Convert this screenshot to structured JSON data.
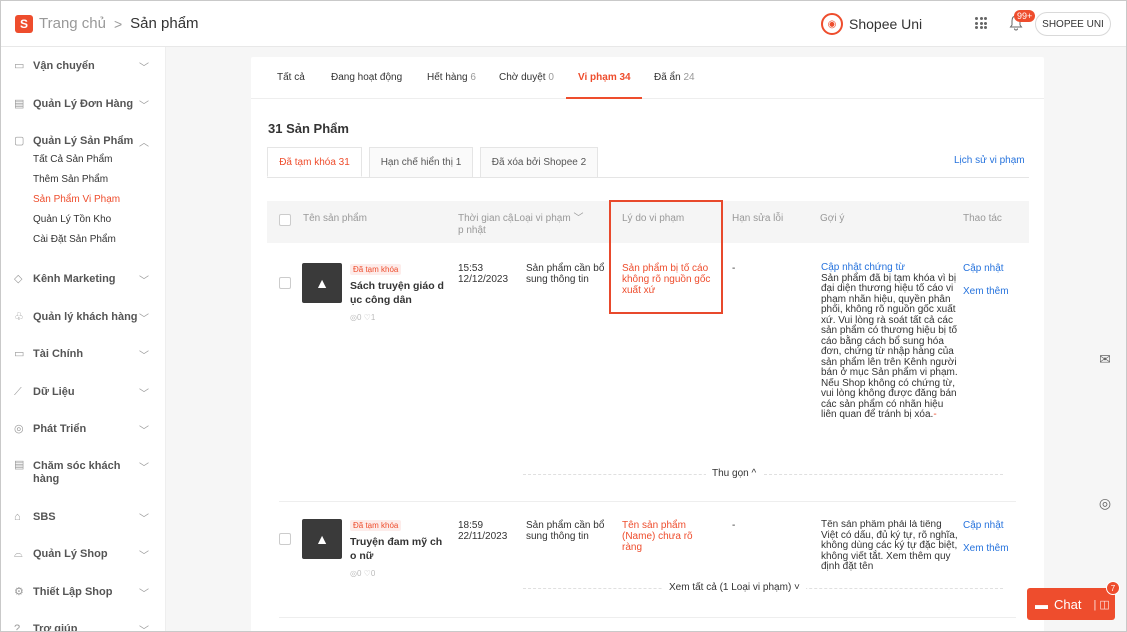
{
  "header": {
    "logo_letter": "S",
    "breadcrumb_home": "Trang chủ",
    "breadcrumb_sep": ">",
    "breadcrumb_current": "Sản phẩm",
    "uni_label": "Shopee Uni",
    "notification_count": "99+",
    "shop_button": "SHOPEE UNI"
  },
  "sidebar": {
    "items": [
      {
        "label": "Vận chuyển",
        "icon": "truck-icon"
      },
      {
        "label": "Quản Lý Đơn Hàng",
        "icon": "clipboard-icon"
      },
      {
        "label": "Quản Lý Sản Phẩm",
        "icon": "box-icon"
      },
      {
        "label": "Kênh Marketing",
        "icon": "tag-icon"
      },
      {
        "label": "Quản lý khách hàng",
        "icon": "users-icon"
      },
      {
        "label": "Tài Chính",
        "icon": "wallet-icon"
      },
      {
        "label": "Dữ Liệu",
        "icon": "chart-icon"
      },
      {
        "label": "Phát Triển",
        "icon": "growth-icon"
      },
      {
        "label": "Chăm sóc khách hàng",
        "icon": "support-icon"
      },
      {
        "label": "SBS",
        "icon": "sbs-icon"
      },
      {
        "label": "Quản Lý Shop",
        "icon": "shop-icon"
      },
      {
        "label": "Thiết Lập Shop",
        "icon": "settings-icon"
      },
      {
        "label": "Trợ giúp",
        "icon": "help-icon"
      }
    ],
    "sub_items": [
      "Tất Cả Sản Phẩm",
      "Thêm Sản Phẩm",
      "Sản Phẩm Vi Phạm",
      "Quản Lý Tồn Kho",
      "Cài Đặt Sản Phẩm"
    ]
  },
  "tabs": [
    {
      "label": "Tất cả",
      "count": ""
    },
    {
      "label": "Đang hoạt động",
      "count": ""
    },
    {
      "label": "Hết hàng",
      "count": "6"
    },
    {
      "label": "Chờ duyệt",
      "count": "0"
    },
    {
      "label": "Vi phạm",
      "count": "34"
    },
    {
      "label": "Đã ẩn",
      "count": "24"
    }
  ],
  "product_count_title": "31 Sản Phẩm",
  "subtabs": [
    "Đã tạm khóa 31",
    "Hạn chế hiển thị 1",
    "Đã xóa bởi Shopee 2"
  ],
  "history_link": "Lịch sử vi phạm",
  "columns": {
    "name": "Tên sản phẩm",
    "time": "Thời gian cậ p nhật",
    "type": "Loại vi phạm",
    "reason": "Lý do vi phạm",
    "deadline": "Hạn sửa lỗi",
    "suggest": "Gợi ý",
    "action": "Thao tác"
  },
  "rows": [
    {
      "tag": "Đã tạm khóa",
      "name": "Sách truyện giáo d ục công dân",
      "stats": "◎0 ♡1",
      "time": "15:53 12/12/2023",
      "type": "Sản phẩm cần bổ sung thông tin",
      "reason": "Sản phẩm bị tố cáo không rõ nguồn gốc xuất xứ",
      "deadline": "-",
      "suggest_title": "Cập nhật chứng từ",
      "suggest_body": "Sản phẩm đã bị tạm khóa vì bị đại diện thương hiệu tố cáo vi phạm nhãn hiệu, quyền phân phối, không rõ nguồn gốc xuất xứ. Vui lòng rà soát tất cả các sản phẩm có thương hiệu bị tố cáo bằng cách bổ sung hóa đơn, chứng từ nhập hàng của sản phẩm lên trên Kênh người bán ở mục Sản phẩm vi phạm. Nếu Shop không có chứng từ, vui lòng không được đăng bán các sản phẩm có nhãn hiệu liên quan để tránh bị xóa.",
      "suggest_end": "-",
      "action_update": "Cập nhật",
      "action_more": "Xem thêm",
      "toggle": "Thu gọn ^"
    },
    {
      "tag": "Đã tạm khóa",
      "name": "Truyện đam mỹ ch o nữ",
      "stats": "◎0 ♡0",
      "time": "18:59 22/11/2023",
      "type": "Sản phẩm cần bổ sung thông tin",
      "reason": "Tên sản phẩm (Name) chưa rõ ràng",
      "deadline": "-",
      "suggest_body": "Tên sản phẩm phải là tiếng Việt có dấu, đủ ký tự, rõ nghĩa, không dùng các ký tự đặc biệt, không viết tắt. Xem thêm quy định đặt tên",
      "action_update": "Cập nhật",
      "action_more": "Xem thêm",
      "toggle": "Xem tất cả (1 Loại vi phạm) ˅"
    }
  ],
  "chat": {
    "label": "Chat",
    "badge": "7"
  },
  "colors": {
    "accent": "#ee4d2d",
    "link": "#2673dd",
    "highlight_box": "#e8492c"
  }
}
